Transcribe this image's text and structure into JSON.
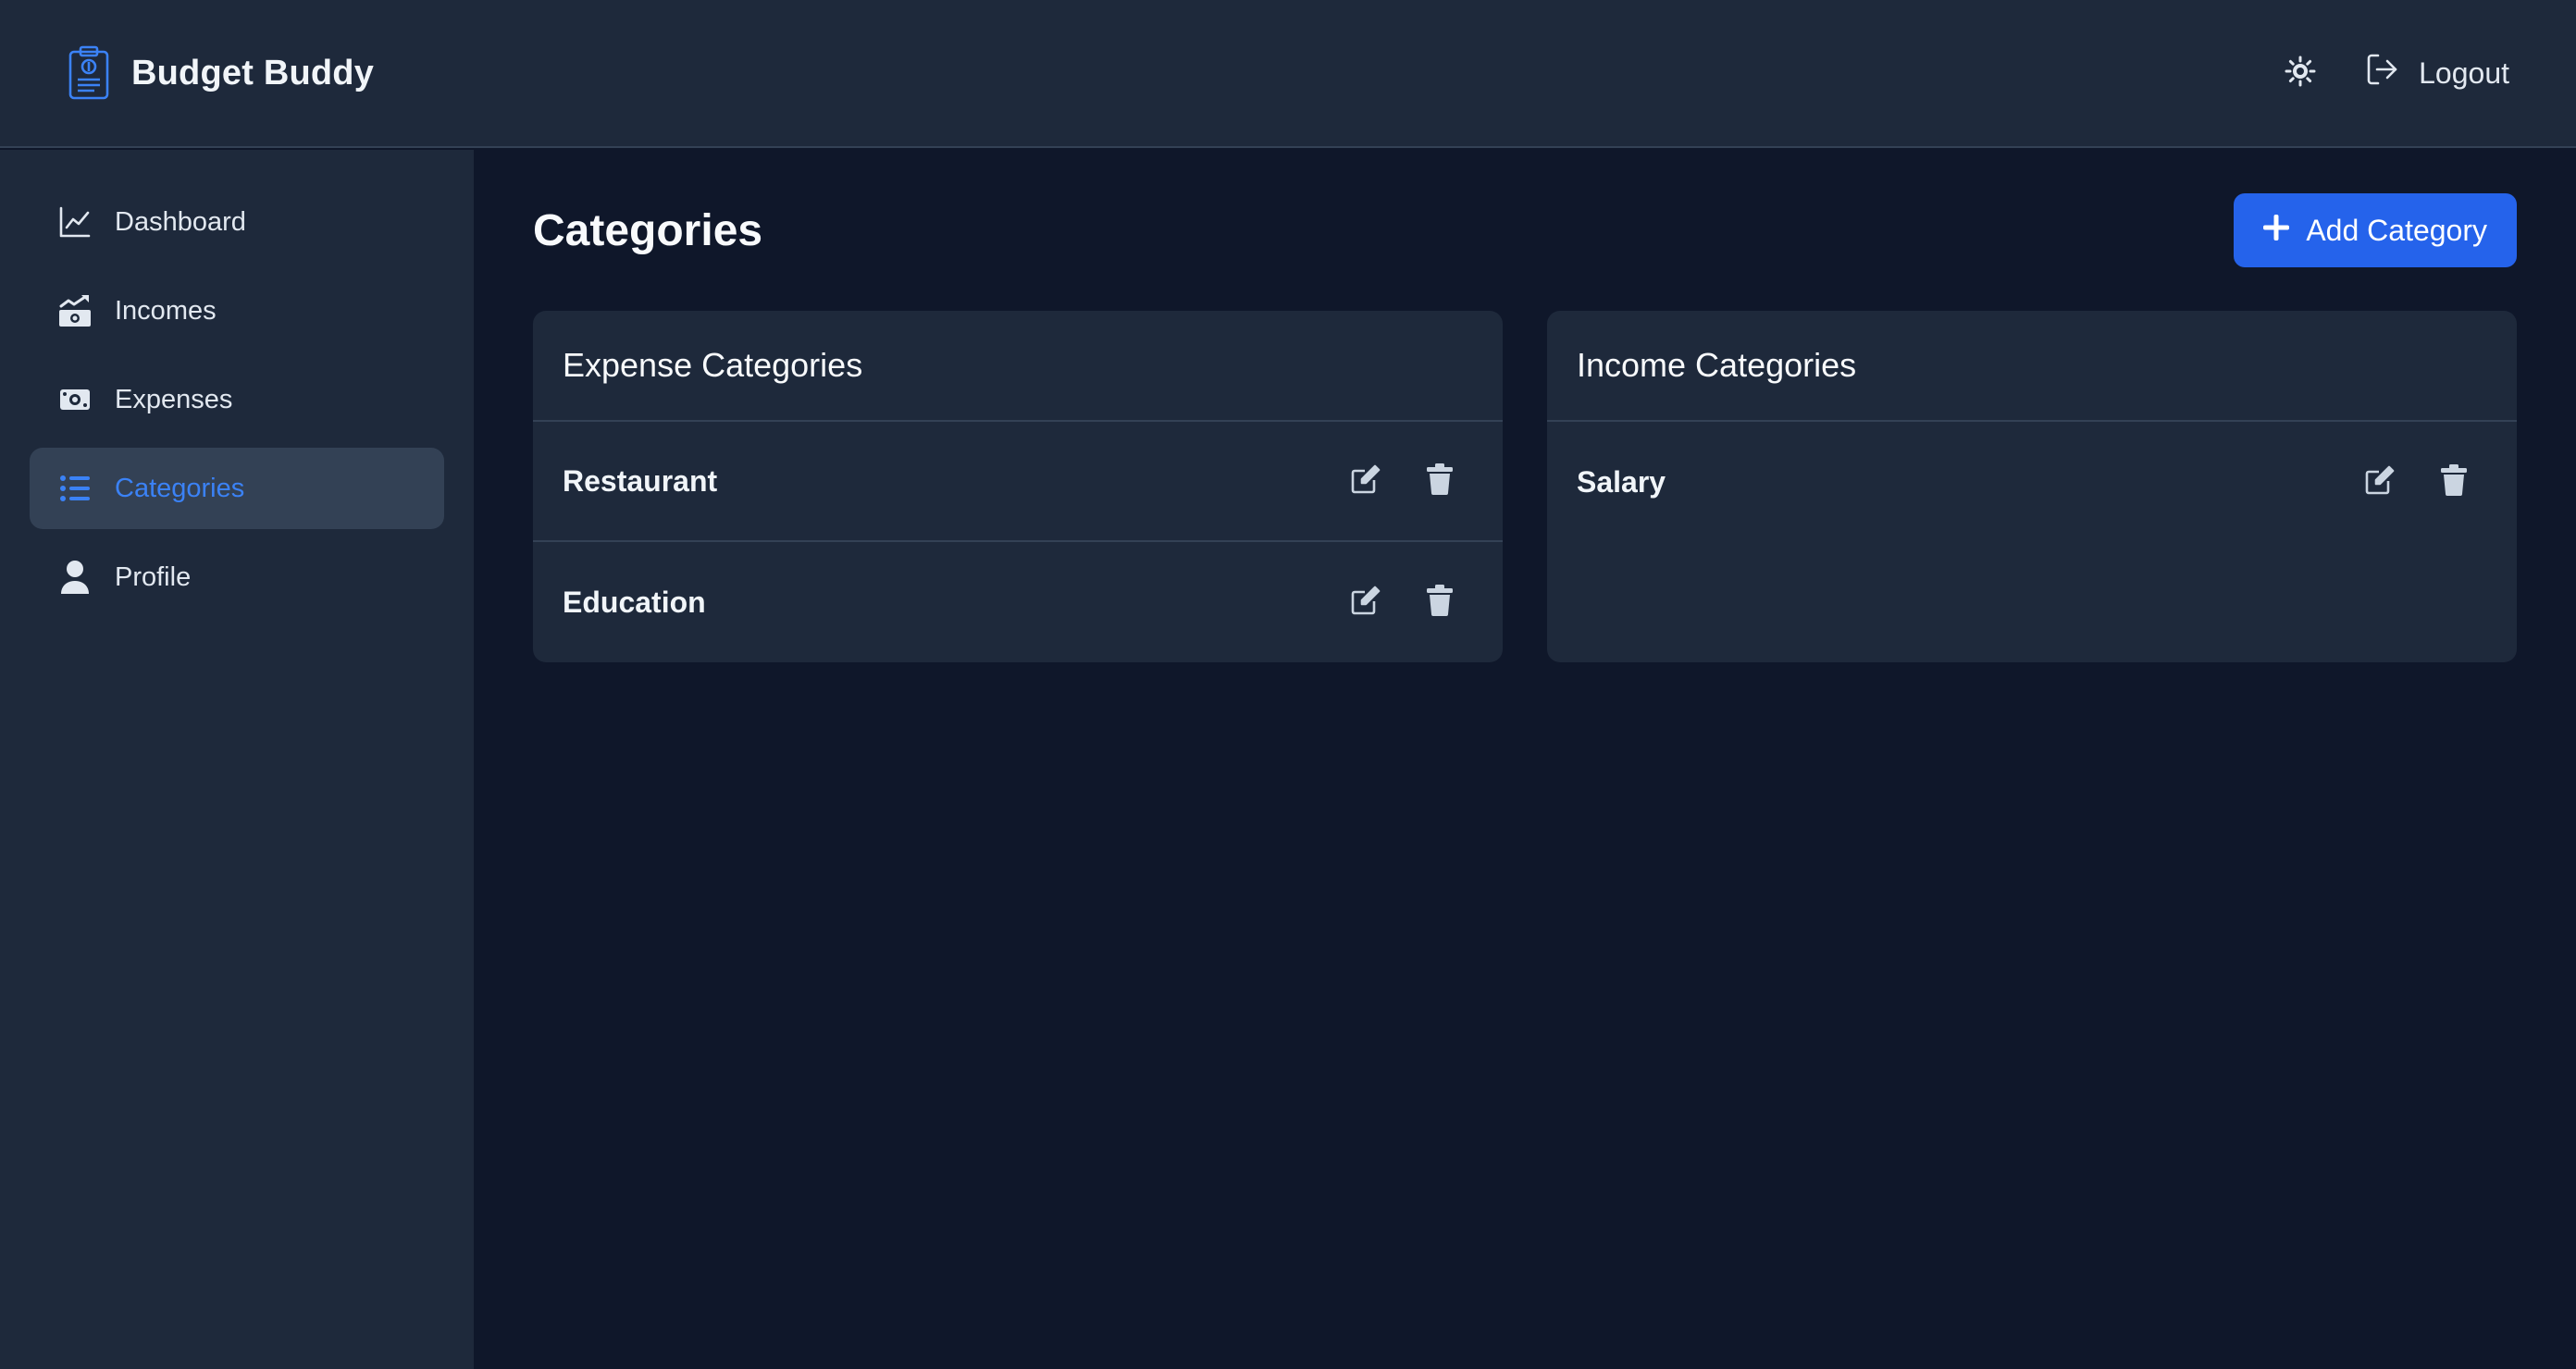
{
  "app": {
    "title": "Budget Buddy",
    "logo_icon": "clipboard-dollar-icon"
  },
  "topbar": {
    "theme_icon": "sun-icon",
    "logout_label": "Logout",
    "logout_icon": "logout-icon"
  },
  "sidebar": {
    "items": [
      {
        "label": "Dashboard",
        "icon": "line-chart-icon",
        "active": false
      },
      {
        "label": "Incomes",
        "icon": "money-up-icon",
        "active": false
      },
      {
        "label": "Expenses",
        "icon": "money-bill-icon",
        "active": false
      },
      {
        "label": "Categories",
        "icon": "list-icon",
        "active": true
      },
      {
        "label": "Profile",
        "icon": "user-icon",
        "active": false
      }
    ]
  },
  "main": {
    "title": "Categories",
    "add_button": "Add Category",
    "expense": {
      "title": "Expense Categories",
      "items": [
        {
          "label": "Restaurant"
        },
        {
          "label": "Education"
        }
      ]
    },
    "income": {
      "title": "Income Categories",
      "items": [
        {
          "label": "Salary"
        }
      ]
    }
  },
  "colors": {
    "background": "#0f172a",
    "surface": "#1e293b",
    "accent": "#2563eb",
    "active_text": "#3b82f6",
    "border": "#334155"
  }
}
